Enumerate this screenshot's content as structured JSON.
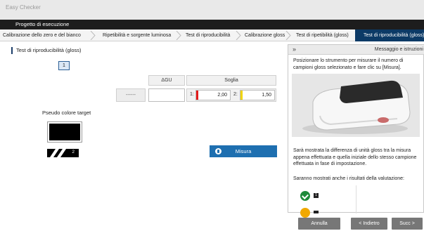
{
  "window": {
    "title": "Easy Checker"
  },
  "project": {
    "title": "Progetto di esecuzione"
  },
  "steps": [
    {
      "label": "Calibrazione dello zero e del bianco"
    },
    {
      "label": "Ripetibilità e sorgente luminosa"
    },
    {
      "label": "Test di riproducibilità"
    },
    {
      "label": "Calibrazione gloss"
    },
    {
      "label": "Test di ripetibilità (gloss)"
    },
    {
      "label": "Test di riproducibilità (gloss)"
    }
  ],
  "main": {
    "section_title": "Test di riproducibilità (gloss)",
    "sample_number": "1",
    "pseudo_color_label": "Pseudo colore target",
    "stripe_number": "2",
    "col_delta_gu": "ΔGU",
    "col_soglia": "Soglia",
    "dash_value": "------",
    "delta_gu_value": "",
    "threshold1_label": "1:",
    "threshold1_value": "2,00",
    "threshold2_label": "2:",
    "threshold2_value": "1,50",
    "measure_button": "Misura"
  },
  "side_panel": {
    "collapse_icon": "»",
    "title": "Messaggio e istruzioni",
    "instruction": "Posizionare lo strumento per misurare il numero di campioni gloss selezionato e fare clic su [Misura].",
    "difference_text": "Sarà mostrata la differenza di unità gloss tra la misura appena effettuata e quella iniziale dello stesso campione effettuata in fase di impostazione.",
    "results_text": "Saranno mostrati anche i risultati della valutazione:",
    "ok_badge": "1"
  },
  "footer": {
    "cancel": "Annulla",
    "back": "< Indietro",
    "next": "Succ >"
  },
  "colors": {
    "accent": "#0c3a66",
    "button_blue": "#1e6fb0",
    "threshold_red": "#e21b1b",
    "threshold_yellow": "#f0d400",
    "ok_green": "#1e8a3a",
    "warn_amber": "#f0a800"
  }
}
